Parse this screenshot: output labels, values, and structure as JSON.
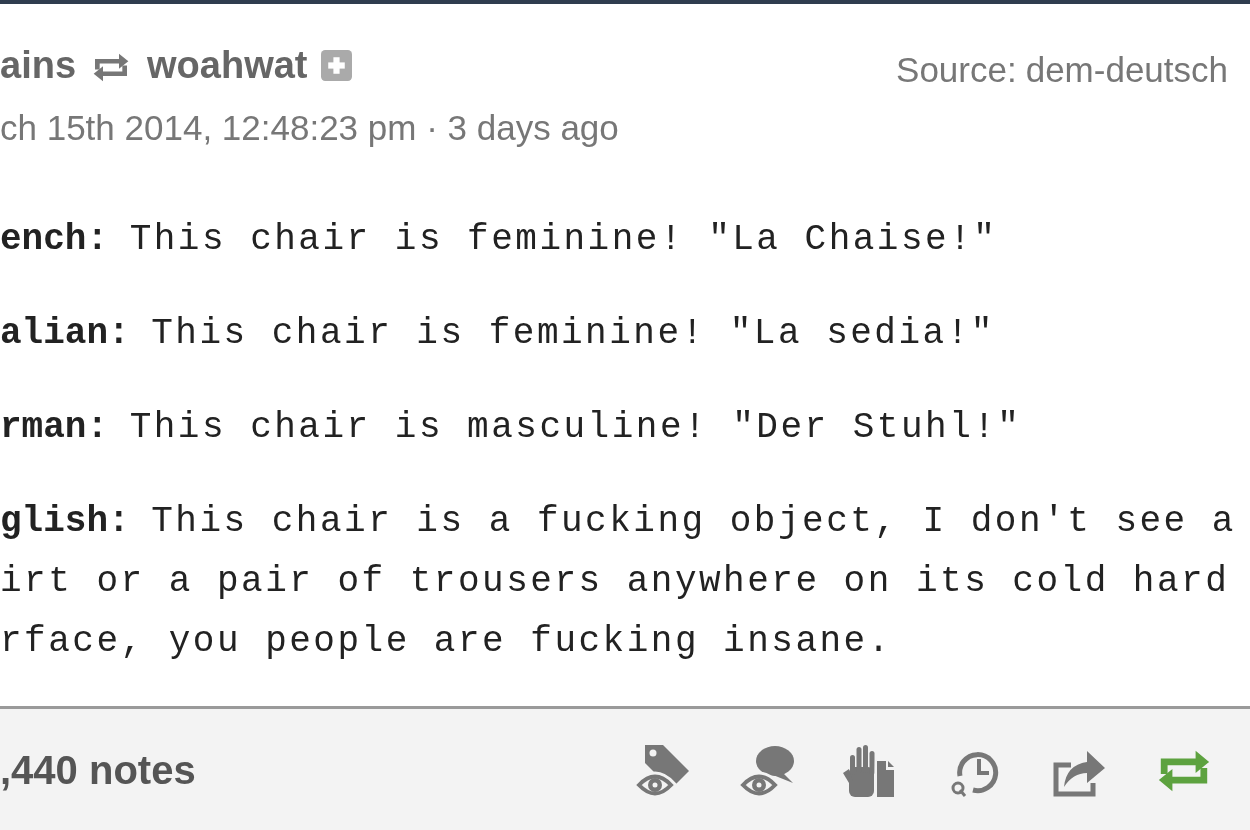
{
  "header": {
    "reblogger": "ains",
    "source_blog": "woahwat",
    "timestamp": "ch 15th 2014, 12:48:23 pm · 3 days ago",
    "source_label": "Source:",
    "source_link": "dem-deutsch"
  },
  "body": [
    {
      "speaker": "ench:",
      "lines": [
        "This chair is feminine! \"La Chaise!\""
      ]
    },
    {
      "speaker": "alian:",
      "lines": [
        "This chair is feminine! \"La sedia!\""
      ]
    },
    {
      "speaker": "rman:",
      "lines": [
        "This chair is masculine! \"Der Stuhl!\""
      ]
    },
    {
      "speaker": "glish:",
      "lines": [
        "This chair is a fucking object, I don't see a",
        "irt or a pair of trousers anywhere on its cold hard",
        "rface, you people are fucking insane."
      ]
    }
  ],
  "footer": {
    "notes": ",440 notes",
    "reblogged": true
  }
}
